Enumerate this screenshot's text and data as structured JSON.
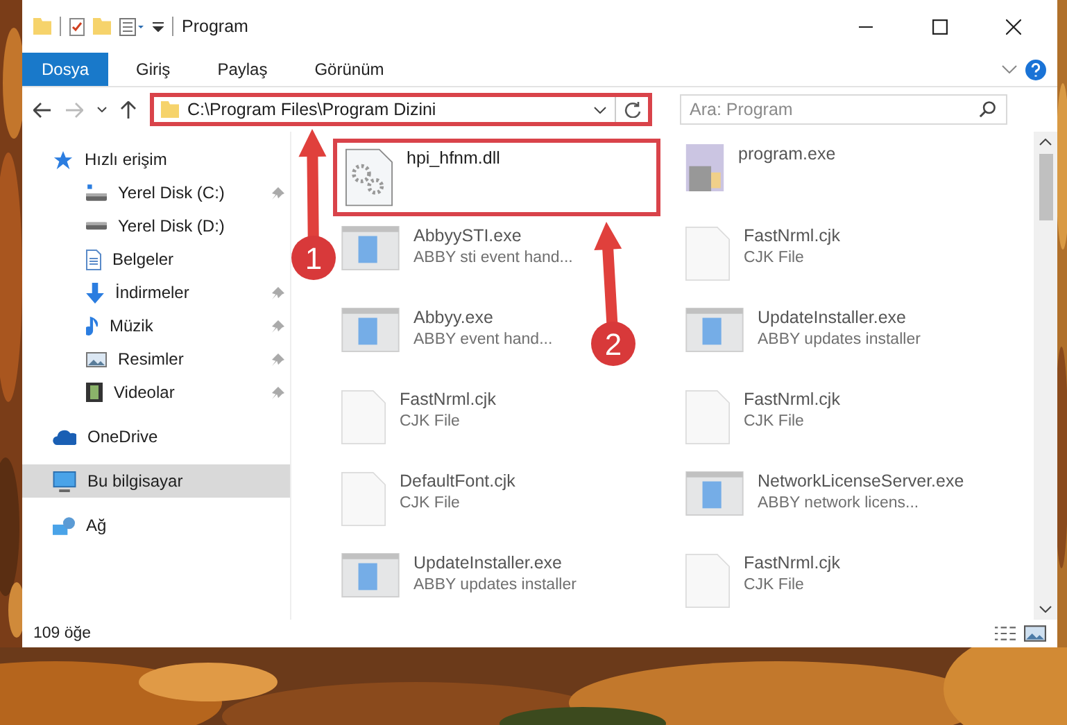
{
  "window": {
    "title": "Program"
  },
  "ribbon_tabs": [
    {
      "label": "Dosya",
      "selected": true
    },
    {
      "label": "Giriş",
      "selected": false
    },
    {
      "label": "Paylaş",
      "selected": false
    },
    {
      "label": "Görünüm",
      "selected": false
    }
  ],
  "address": {
    "path": "C:\\Program Files\\Program Dizini",
    "highlighted": true
  },
  "search": {
    "placeholder": "Ara: Program"
  },
  "sidebar": {
    "items": [
      {
        "label": "Hızlı erişim",
        "kind": "quick",
        "pinned": false,
        "selected": false
      },
      {
        "label": "Yerel Disk (C:)",
        "kind": "system",
        "pinned": true,
        "selected": false
      },
      {
        "label": "Yerel Disk (D:)",
        "kind": "drive",
        "pinned": false,
        "selected": false
      },
      {
        "label": "Belgeler",
        "kind": "documents",
        "pinned": false,
        "selected": false
      },
      {
        "label": "İndirmeler",
        "kind": "downloads",
        "pinned": true,
        "selected": false
      },
      {
        "label": "Müzik",
        "kind": "music",
        "pinned": true,
        "selected": false
      },
      {
        "label": "Resimler",
        "kind": "pictures",
        "pinned": true,
        "selected": false
      },
      {
        "label": "Videolar",
        "kind": "videos",
        "pinned": true,
        "selected": false
      },
      {
        "label": "OneDrive",
        "kind": "cloud",
        "pinned": false,
        "selected": false
      },
      {
        "label": "Bu bilgisayar",
        "kind": "computer",
        "pinned": false,
        "selected": true
      },
      {
        "label": "Ağ",
        "kind": "network",
        "pinned": false,
        "selected": false
      }
    ]
  },
  "files": [
    {
      "name": "hpi_hfnm.dll",
      "kind": "dll",
      "highlighted": true
    },
    {
      "name": "program.exe",
      "kind": "setup",
      "highlighted": false
    },
    {
      "name": "AbbyySTI.exe",
      "description": "ABBY sti event hand...",
      "kind": "exe",
      "highlighted": false
    },
    {
      "name": "FastNrml.cjk",
      "description": "CJK File",
      "kind": "file",
      "highlighted": false
    },
    {
      "name": "Abbyy.exe",
      "description": "ABBY event hand...",
      "kind": "exe",
      "highlighted": false
    },
    {
      "name": "UpdateInstaller.exe",
      "description": "ABBY updates installer",
      "kind": "exe",
      "highlighted": false
    },
    {
      "name": "FastNrml.cjk",
      "description": "CJK File",
      "kind": "file",
      "highlighted": false
    },
    {
      "name": "FastNrml.cjk",
      "description": "CJK File",
      "kind": "file",
      "highlighted": false
    },
    {
      "name": "DefaultFont.cjk",
      "description": "CJK File",
      "kind": "file",
      "highlighted": false
    },
    {
      "name": "NetworkLicenseServer.exe",
      "description": "ABBY network licens...",
      "kind": "exe",
      "highlighted": false
    },
    {
      "name": "UpdateInstaller.exe",
      "description": "ABBY updates installer",
      "kind": "exe",
      "highlighted": false
    },
    {
      "name": "FastNrml.cjk",
      "description": "CJK File",
      "kind": "file",
      "highlighted": false
    }
  ],
  "callouts": [
    {
      "number": "1"
    },
    {
      "number": "2"
    }
  ],
  "status_bar": {
    "count": "109 öğe"
  }
}
